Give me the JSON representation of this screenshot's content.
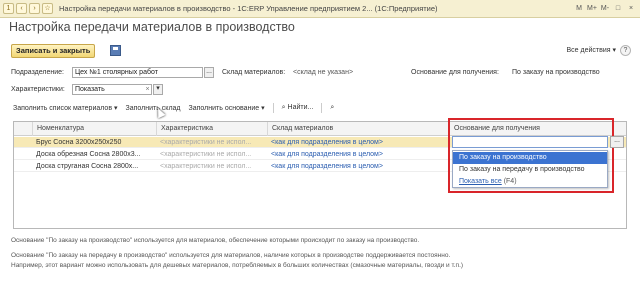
{
  "window": {
    "title": "Настройка передачи материалов в производство - 1С:ERP Управление предприятием 2... (1С:Предприятие)",
    "controls": [
      "M",
      "M+",
      "M-",
      "□",
      "×"
    ]
  },
  "form": {
    "title": "Настройка передачи материалов в производство",
    "save_close": "Записать и закрыть",
    "all_actions": "Все действия ▾",
    "help": "?"
  },
  "filters": {
    "division_label": "Подразделение:",
    "division_value": "Цех №1 столярных работ",
    "warehouse_label": "Склад материалов:",
    "warehouse_value": "<склад не указан>",
    "basis_label": "Основание для получения:",
    "basis_value": "По заказу на производство",
    "char_label": "Характеристики:",
    "char_value": "Показать"
  },
  "toolbar": {
    "fill_materials": "Заполнить список материалов ▾",
    "fill_warehouse": "Заполнить склад",
    "fill_basis": "Заполнить основание ▾",
    "find": "Найти..."
  },
  "table": {
    "headers": [
      "Номенклатура",
      "Характеристика",
      "Склад материалов",
      "Основание для получения"
    ],
    "rows": [
      {
        "item": "Брус Сосна 3200x250x250",
        "char": "<характеристики не испол...",
        "warehouse": "<как для подразделения в целом>",
        "basis": ""
      },
      {
        "item": "Доска обрезная Сосна 2800x3...",
        "char": "<характеристики не испол...",
        "warehouse": "<как для подразделения в целом>",
        "basis": ""
      },
      {
        "item": "Доска струганая Сосна 2800x...",
        "char": "<характеристики не испол...",
        "warehouse": "<как для подразделения в целом>",
        "basis": ""
      }
    ]
  },
  "dropdown": {
    "options": [
      "По заказу на производство",
      "По заказу на передачу в производство"
    ],
    "show_all": "Показать все",
    "show_all_key": "(F4)"
  },
  "notes": [
    "Основание \"По заказу на производство\" используется для материалов, обеспечение которыми происходит по заказу на производство.",
    "Основание \"По заказу на передачу в производство\" используется для материалов, наличие которых в производстве поддерживается постоянно.",
    "Например, этот вариант можно использовать для дешевых материалов, потребляемых в больших количествах (смазочные материалы, гвозди и т.п.)"
  ]
}
